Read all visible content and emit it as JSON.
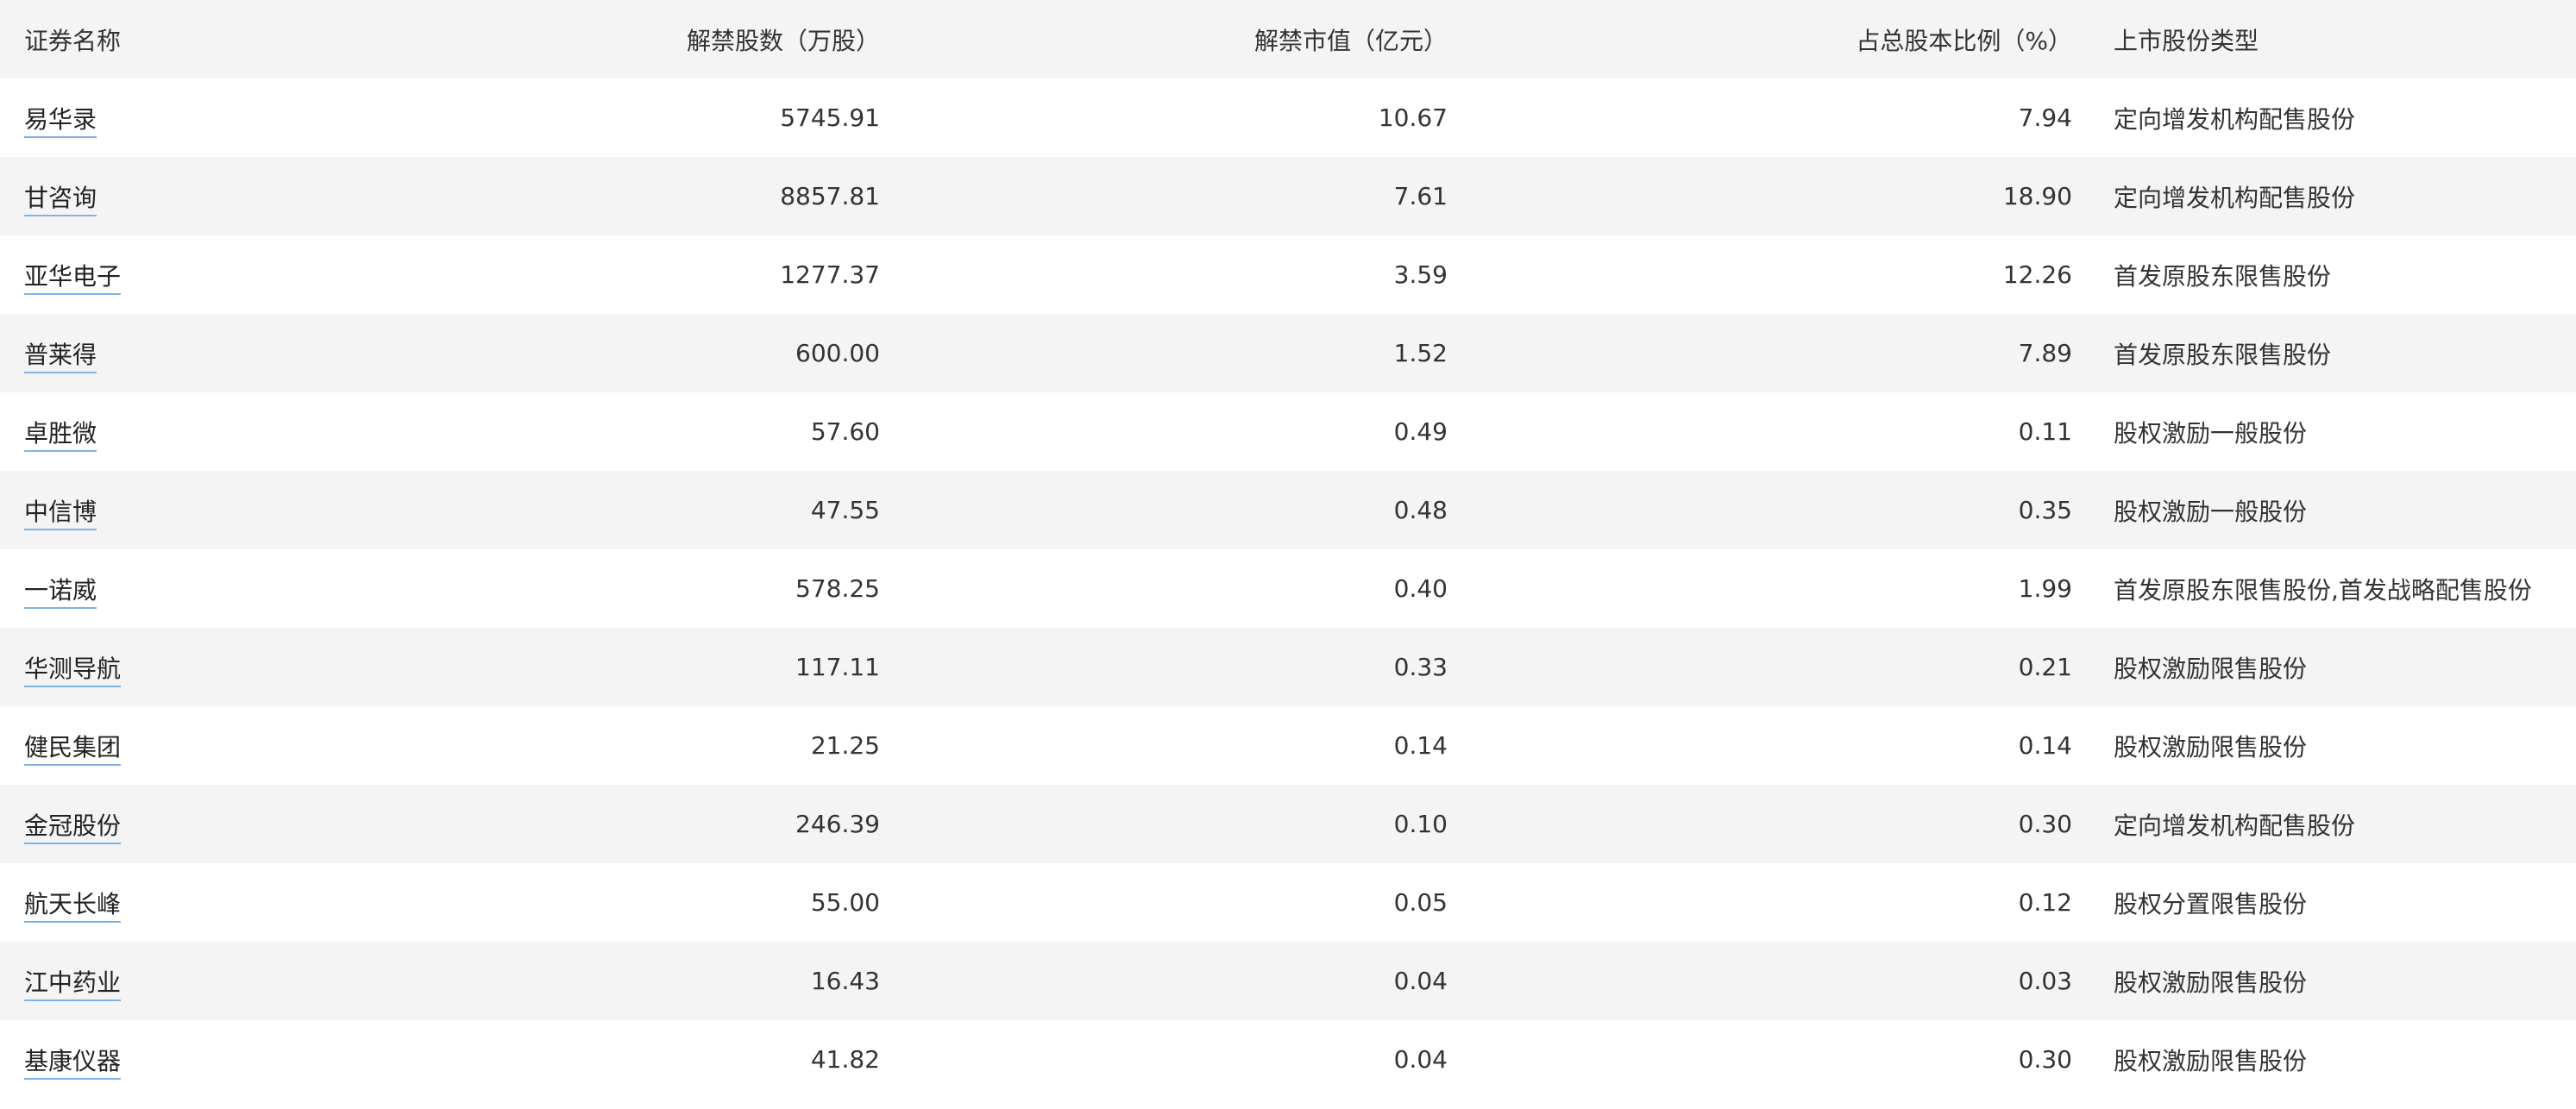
{
  "table": {
    "headers": [
      "证券名称",
      "解禁股数（万股）",
      "解禁市值（亿元）",
      "占总股本比例（%）",
      "上市股份类型"
    ],
    "rows": [
      [
        "易华录",
        "5745.91",
        "10.67",
        "7.94",
        "定向增发机构配售股份"
      ],
      [
        "甘咨询",
        "8857.81",
        "7.61",
        "18.90",
        "定向增发机构配售股份"
      ],
      [
        "亚华电子",
        "1277.37",
        "3.59",
        "12.26",
        "首发原股东限售股份"
      ],
      [
        "普莱得",
        "600.00",
        "1.52",
        "7.89",
        "首发原股东限售股份"
      ],
      [
        "卓胜微",
        "57.60",
        "0.49",
        "0.11",
        "股权激励一般股份"
      ],
      [
        "中信博",
        "47.55",
        "0.48",
        "0.35",
        "股权激励一般股份"
      ],
      [
        "一诺威",
        "578.25",
        "0.40",
        "1.99",
        "首发原股东限售股份,首发战略配售股份"
      ],
      [
        "华测导航",
        "117.11",
        "0.33",
        "0.21",
        "股权激励限售股份"
      ],
      [
        "健民集团",
        "21.25",
        "0.14",
        "0.14",
        "股权激励限售股份"
      ],
      [
        "金冠股份",
        "246.39",
        "0.10",
        "0.30",
        "定向增发机构配售股份"
      ],
      [
        "航天长峰",
        "55.00",
        "0.05",
        "0.12",
        "股权分置限售股份"
      ],
      [
        "江中药业",
        "16.43",
        "0.04",
        "0.03",
        "股权激励限售股份"
      ],
      [
        "基康仪器",
        "41.82",
        "0.04",
        "0.30",
        "股权激励限售股份"
      ]
    ]
  }
}
